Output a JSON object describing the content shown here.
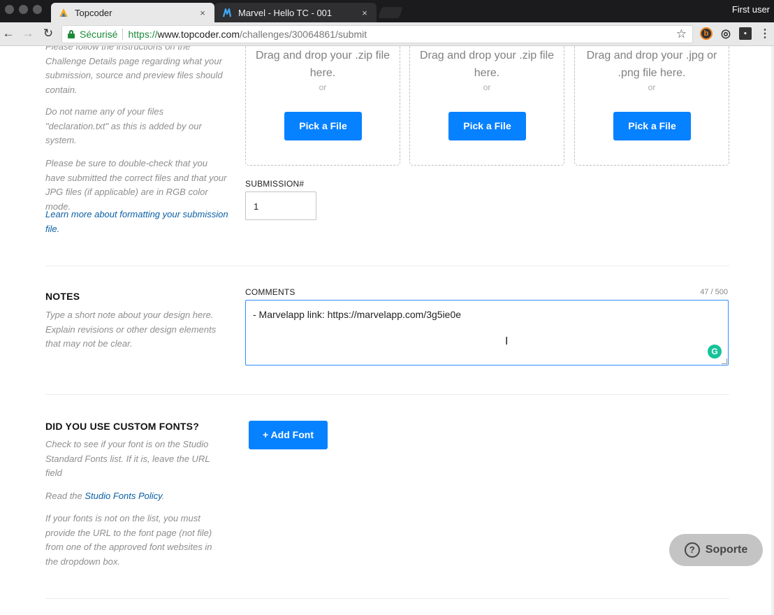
{
  "browser": {
    "tabs": [
      {
        "title": "Topcoder",
        "close": "×"
      },
      {
        "title": "Marvel - Hello TC - 001",
        "close": "×"
      }
    ],
    "profile": "First user",
    "nav": {
      "back": "←",
      "forward": "→",
      "reload": "↻"
    },
    "address": {
      "secure_label": "Sécurisé",
      "scheme": "https://",
      "host": "www.topcoder.com",
      "path": "/challenges/30064861/submit"
    },
    "bookmark_star": "☆",
    "extensions": [
      "b",
      "◎",
      "▪"
    ]
  },
  "upload_help": {
    "paragraphs": [
      "Please follow the instructions on the Challenge Details page regarding what your submission, source and preview files should contain.",
      "Do not name any of your files \"declaration.txt\" as this is added by our system.",
      "Please be sure to double-check that you have submitted the correct files and that your JPG files (if applicable) are in RGB color mode."
    ],
    "link": "Learn more about formatting your submission file."
  },
  "drop_zones": [
    {
      "text": "Drag and drop your .zip file here.",
      "or": "or",
      "button": "Pick a File"
    },
    {
      "text": "Drag and drop your .zip file here.",
      "or": "or",
      "button": "Pick a File"
    },
    {
      "text": "Drag and drop your .jpg or .png file here.",
      "or": "or",
      "button": "Pick a File"
    }
  ],
  "submission": {
    "label": "SUBMISSION#",
    "value": "1"
  },
  "notes": {
    "title": "NOTES",
    "help": "Type a short note about your design here. Explain revisions or other design elements that may not be clear.",
    "comments_label": "COMMENTS",
    "char_count": "47 / 500",
    "comments_value": "- Marvelapp link: https://marvelapp.com/3g5ie0e",
    "grammarly": "G"
  },
  "fonts": {
    "title": "DID YOU USE CUSTOM FONTS?",
    "help1": "Check to see if your font is on the Studio Standard Fonts list. If it is, leave the URL field",
    "read_prefix": "Read the ",
    "policy_link": "Studio Fonts Policy",
    "read_suffix": ".",
    "help2": "If your fonts is not on the list, you must provide the URL to the font page (not file) from one of the approved font websites in the dropdown box.",
    "add_button": "+ Add Font"
  },
  "support": {
    "label": "Soporte",
    "icon": "?"
  },
  "colors": {
    "primary_button": "#0681ff",
    "link": "#0b5fa5",
    "secure_green": "#1b8a3a",
    "focus_border": "#2f8cff"
  }
}
